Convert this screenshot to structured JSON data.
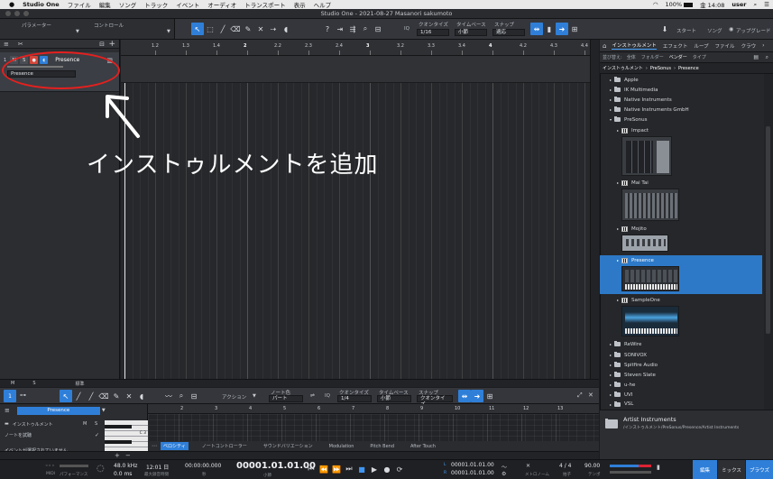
{
  "menubar": {
    "app_name": "Studio One",
    "items": [
      "ファイル",
      "編集",
      "ソング",
      "トラック",
      "イベント",
      "オーディオ",
      "トランスポート",
      "表示",
      "ヘルプ"
    ],
    "battery": "100%",
    "datetime": "金 14:08",
    "user": "user"
  },
  "window": {
    "title": "Studio One - 2021-08-27 Masanori sakumoto"
  },
  "toolbar": {
    "parameters": "パラメーター",
    "control": "コントロール",
    "quantize_label": "クオンタイズ",
    "quantize_value": "1/16",
    "timebase_label": "タイムベース",
    "timebase_value": "小節",
    "snap_label": "スナップ",
    "snap_value": "適応",
    "iq": "IQ",
    "start": "スタート",
    "song": "ソング",
    "upgrade": "アップグレード"
  },
  "track": {
    "number": "1",
    "m": "M",
    "s": "S",
    "name": "Presence",
    "instrument": "Presence"
  },
  "ruler_marks": [
    "1.2",
    "1.3",
    "1.4",
    "2",
    "2.2",
    "2.3",
    "2.4",
    "3",
    "3.2",
    "3.3",
    "3.4",
    "4",
    "4.2",
    "4.3",
    "4.4"
  ],
  "arrange_bottom": {
    "m": "M",
    "s": "S",
    "std": "標準"
  },
  "annotation": {
    "text": "インストゥルメントを追加"
  },
  "browser": {
    "tabs": [
      "インストゥルメント",
      "エフェクト",
      "ループ",
      "ファイル",
      "クラウ"
    ],
    "sort_label": "並び替え:",
    "sort_options": [
      "全体",
      "フォルダー",
      "ベンダー",
      "タイプ"
    ],
    "sort_active": "ベンダー",
    "path": [
      "インストゥルメント",
      "PreSonus",
      "Presence"
    ],
    "vendors": [
      "Apple",
      "IK Multimedia",
      "Native Instruments",
      "Native Instruments GmbH",
      "PreSonus"
    ],
    "presonus_items": [
      "Impact",
      "Mai Tai",
      "Mojito",
      "Presence",
      "SampleOne"
    ],
    "vendors_after": [
      "ReWire",
      "SONIVOX",
      "Spitfire Audio",
      "Steven Slate",
      "u-he",
      "UVI",
      "VSL"
    ],
    "info_title": "Artist Instruments",
    "info_path": "/インストゥルメント/PreSonus/Presence/Artist Instruments"
  },
  "editor": {
    "action": "アクション",
    "note_color_label": "ノート色",
    "note_color_value": "パート",
    "quantize_label": "クオンタイズ",
    "quantize_value": "1/4",
    "timebase_label": "タイムベース",
    "timebase_value": "小節",
    "snap_label": "スナップ",
    "snap_value": "クオンタイズ",
    "iq": "IQ",
    "channel_name": "Presence",
    "track_label": "インストゥルメント",
    "m": "M",
    "s": "S",
    "audition": "ノートを試聴",
    "no_event": "イベントが選択されていません",
    "c3": "C 3",
    "ruler": [
      "2",
      "3",
      "4",
      "5",
      "6",
      "7",
      "8",
      "9",
      "10",
      "11",
      "12",
      "13"
    ],
    "tabs": [
      "ベロシティ",
      "ノートコントローラー",
      "サウンドバリエーション",
      "Modulation",
      "Pitch Bend",
      "After Touch"
    ]
  },
  "transport": {
    "midi": "MIDI",
    "performance": "パフォーマンス",
    "sample_rate": "48.0 kHz",
    "latency": "0.0 ms",
    "rec_time": "12:01 日",
    "max_rec": "最大録音時間",
    "time_sec": "00:00:00.000",
    "sec_label": "秒",
    "position": "00001.01.01.00",
    "bar_label": "小節",
    "loop_l": "00001.01.01.00",
    "loop_r": "00001.01.01.00",
    "l": "L",
    "r": "R",
    "metronome": "メトロノーム",
    "signature": "4 / 4",
    "sig_label": "拍子",
    "tempo": "90.00",
    "tempo_label": "テンポ",
    "edit": "編集",
    "mix": "ミックス",
    "browse": "ブラウズ"
  }
}
